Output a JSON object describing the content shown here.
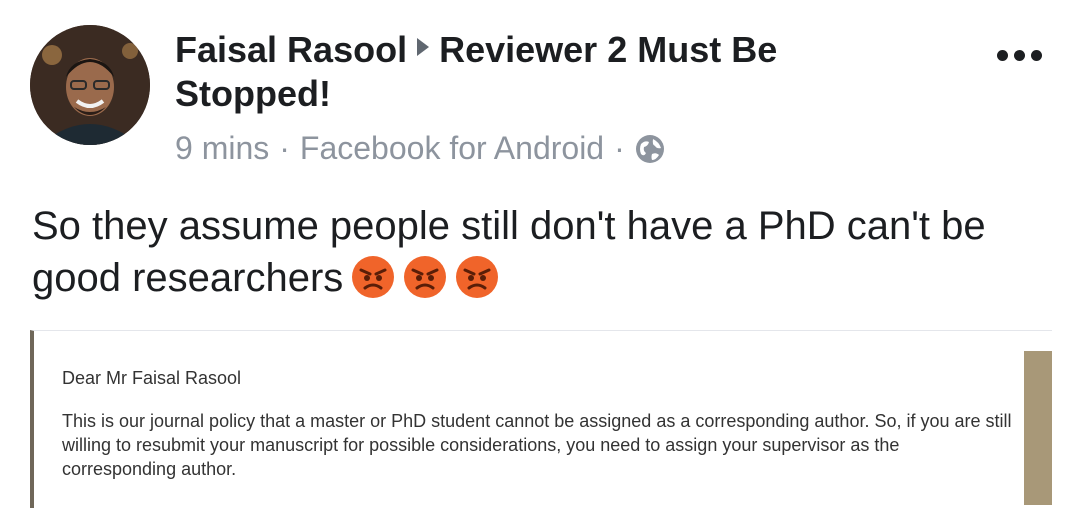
{
  "post": {
    "author": "Faisal Rasool",
    "group": "Reviewer 2 Must Be Stopped!",
    "time": "9 mins",
    "source": "Facebook for Android",
    "dot": "·",
    "text": "So they assume people still don't have a PhD can't be good researchers",
    "emoji_count": 3,
    "emoji_name": "angry-face-icon"
  },
  "attachment": {
    "greeting": "Dear Mr Faisal Rasool",
    "body": "This is our journal policy that a master or PhD student cannot be assigned as a corresponding author. So, if you are still willing to resubmit your manuscript for possible considerations, you need to assign your supervisor as the corresponding author."
  },
  "colors": {
    "text": "#1c1e21",
    "meta": "#8d949e",
    "angry_emoji": "#f0642a"
  }
}
